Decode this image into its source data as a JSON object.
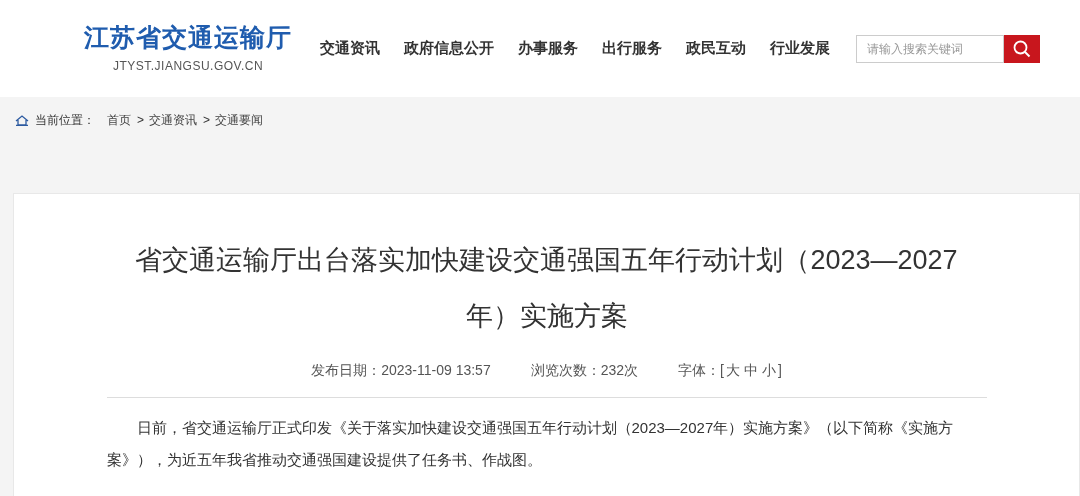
{
  "header": {
    "logo_title": "江苏省交通运输厅",
    "logo_subtitle": "JTYST.JIANGSU.GOV.CN",
    "nav": [
      "交通资讯",
      "政府信息公开",
      "办事服务",
      "出行服务",
      "政民互动",
      "行业发展"
    ],
    "search": {
      "placeholder": "请输入搜索关键词"
    }
  },
  "breadcrumb": {
    "label": "当前位置：",
    "items": [
      "首页",
      "交通资讯",
      "交通要闻"
    ],
    "separator": ">"
  },
  "article": {
    "title": "省交通运输厅出台落实加快建设交通强国五年行动计划（2023—2027年）实施方案",
    "meta": {
      "date_label": "发布日期：",
      "date": "2023-11-09 13:57",
      "views_label": "浏览次数：",
      "views": "232次",
      "font_label": "字体：",
      "font_open": "[",
      "font_sizes": [
        "大",
        "中",
        "小"
      ],
      "font_close": "]"
    },
    "paragraphs": [
      "日前，省交通运输厅正式印发《关于落实加快建设交通强国五年行动计划（2023—2027年）实施方案》（以下简称《实施方案》），为近五年我省推动交通强国建设提供了任务书、作战图。"
    ]
  }
}
